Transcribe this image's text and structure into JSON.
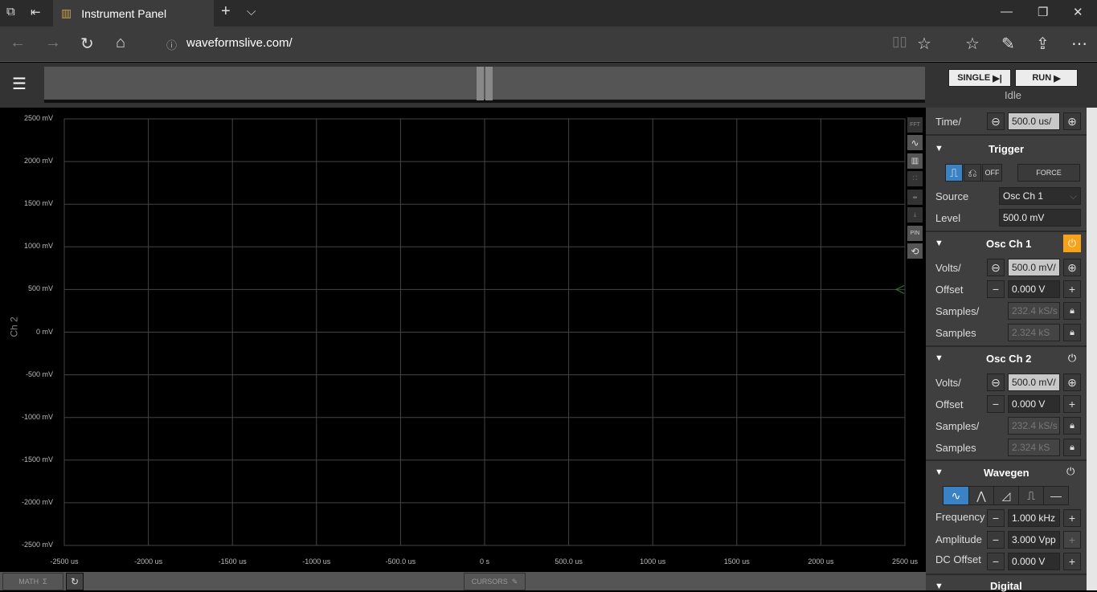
{
  "browser": {
    "tab_title": "Instrument Panel",
    "url": "waveformslive.com/"
  },
  "controls": {
    "single": "SINGLE",
    "run": "RUN",
    "status": "Idle"
  },
  "time": {
    "label": "Time/",
    "value": "500.0 us/"
  },
  "trigger": {
    "title": "Trigger",
    "off": "OFF",
    "force": "FORCE",
    "source_label": "Source",
    "source_value": "Osc Ch 1",
    "level_label": "Level",
    "level_value": "500.0 mV"
  },
  "ch1": {
    "title": "Osc Ch 1",
    "volts_label": "Volts/",
    "volts": "500.0 mV/",
    "offset_label": "Offset",
    "offset": "0.000 V",
    "rate_label": "Samples/",
    "rate": "232.4 kS/s",
    "samples_label": "Samples",
    "samples": "2.324 kS",
    "power_color": "#f7a21b"
  },
  "ch2": {
    "title": "Osc Ch 2",
    "volts_label": "Volts/",
    "volts": "500.0 mV/",
    "offset_label": "Offset",
    "offset": "0.000 V",
    "rate_label": "Samples/",
    "rate": "232.4 kS/s",
    "samples_label": "Samples",
    "samples": "2.324 kS"
  },
  "wavegen": {
    "title": "Wavegen",
    "freq_label": "Frequency",
    "freq": "1.000 kHz",
    "amp_label": "Amplitude",
    "amp": "3.000 Vpp",
    "dc_label": "DC Offset",
    "dc": "0.000 V"
  },
  "digital": {
    "title": "Digital"
  },
  "plot": {
    "channel_label": "Ch 2",
    "y_ticks": [
      "2500 mV",
      "2000 mV",
      "1500 mV",
      "1000 mV",
      "500 mV",
      "0 mV",
      "-500 mV",
      "-1000 mV",
      "-1500 mV",
      "-2000 mV",
      "-2500 mV"
    ],
    "x_ticks": [
      "-2500 us",
      "-2000 us",
      "-1500 us",
      "-1000 us",
      "-500.0 us",
      "0 s",
      "500.0 us",
      "1000 us",
      "1500 us",
      "2000 us",
      "2500 us"
    ],
    "trigger_level_mv": 500
  },
  "toolbar": {
    "fft": "FFT",
    "pin": "PIN"
  },
  "bottom": {
    "math": "MATH",
    "cursors": "CURSORS"
  }
}
